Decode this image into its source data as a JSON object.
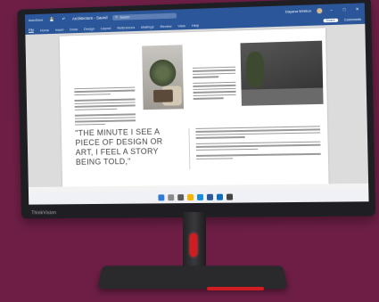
{
  "app": {
    "autosave": "AutoSave",
    "doc_title": "Architecture - Saved",
    "search_placeholder": "Search",
    "user_name": "Dayana Whitton"
  },
  "ribbon": {
    "tabs": [
      "File",
      "Home",
      "Insert",
      "Draw",
      "Design",
      "Layout",
      "References",
      "Mailings",
      "Review",
      "View",
      "Help"
    ],
    "share": "Share",
    "comments": "Comments"
  },
  "document": {
    "quote": "\"THE MINUTE I SEE A PIECE OF DESIGN OR ART, I FEEL A STORY BEING TOLD,\""
  },
  "brand": {
    "bezel_logo": "ThinkVision"
  },
  "colors": {
    "background": "#6e1e45",
    "word_blue": "#2b579a",
    "stand_accent": "#d21c24"
  }
}
